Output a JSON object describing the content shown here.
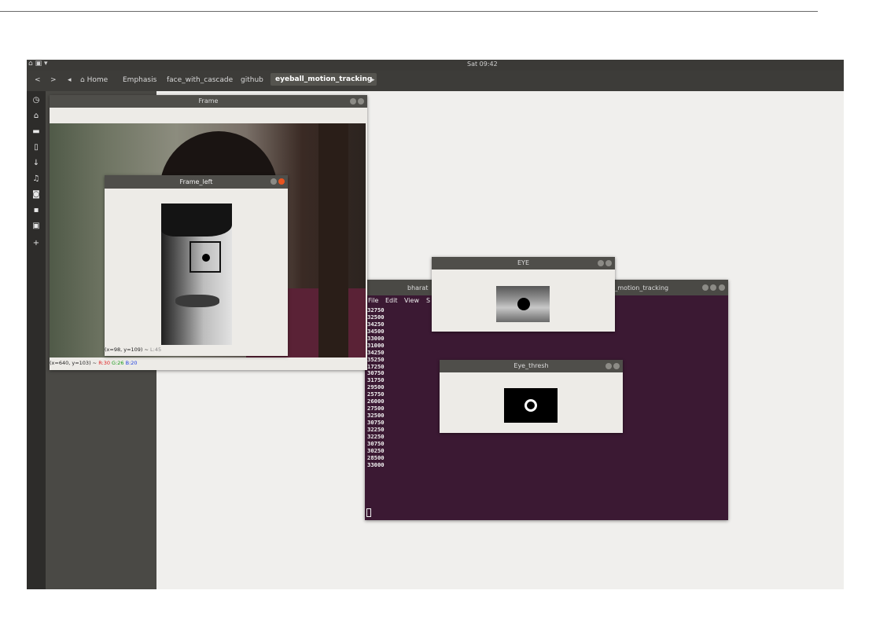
{
  "topbar": {
    "activities": "⌂ ▣ ▾",
    "clock": "Sat 09:42"
  },
  "pathbar": {
    "back": "<",
    "forward": ">",
    "left_arrow": "◂",
    "items": [
      "Home",
      "Emphasis",
      "face_with_cascade",
      "github",
      "eyeball_motion_tracking"
    ],
    "right_arrow": "▸"
  },
  "dock": {
    "icons": [
      "clock-icon",
      "home-icon",
      "folder-icon",
      "document-icon",
      "download-icon",
      "music-icon",
      "camera-icon",
      "video-icon",
      "trash-icon",
      "plus-icon"
    ]
  },
  "windows": {
    "frame": {
      "title": "Frame",
      "status": {
        "prefix": "(x=640, y=103) ~ ",
        "r": "R:30",
        "g": "G:26",
        "b": "B:20"
      }
    },
    "frame_left": {
      "title": "Frame_left",
      "status": {
        "prefix": "(x=98, y=109) ~ ",
        "l": "L:45"
      }
    },
    "terminal": {
      "title_left": "bharat",
      "title_right": "all_motion_tracking",
      "menu": [
        "File",
        "Edit",
        "View",
        "S"
      ],
      "lines": [
        "32750",
        "32500",
        "34250",
        "34500",
        "33000",
        "31000",
        "34250",
        "35250",
        "17250",
        "30750",
        "31750",
        "29500",
        "25750",
        "26000",
        "27500",
        "32500",
        "30750",
        "32250",
        "32250",
        "30750",
        "30250",
        "28500",
        "33000"
      ]
    },
    "eye": {
      "title": "EYE"
    },
    "eye_thresh": {
      "title": "Eye_thresh"
    }
  },
  "colors": {
    "terminal_bg": "#3b1933",
    "close_button": "#e95420",
    "panel": "#4a4945"
  }
}
